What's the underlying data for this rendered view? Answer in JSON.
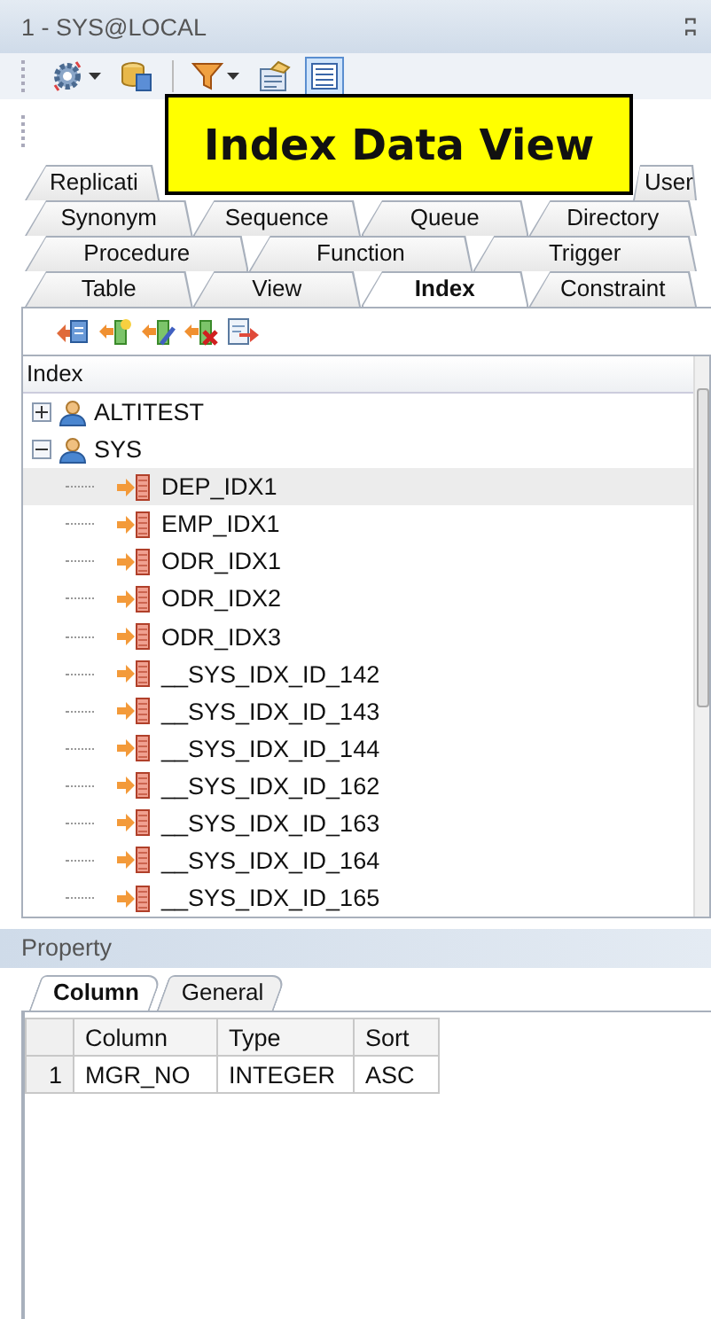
{
  "panel": {
    "title": "1 - SYS@LOCAL",
    "pin": "ʭ"
  },
  "toolbar": [
    {
      "kind": "gear",
      "dropdown": true,
      "pressed": false
    },
    {
      "kind": "database",
      "dropdown": false,
      "pressed": false
    },
    {
      "kind": "filter",
      "dropdown": true,
      "pressed": false
    },
    {
      "kind": "properties",
      "dropdown": false,
      "pressed": false
    },
    {
      "kind": "list",
      "dropdown": false,
      "pressed": true
    }
  ],
  "callout": {
    "text": "Index Data View"
  },
  "object_tab_rows": [
    [
      {
        "label": "Replicati",
        "selected": false
      },
      {
        "label": "User",
        "selected": false
      }
    ],
    [
      {
        "label": "Synonym",
        "selected": false
      },
      {
        "label": "Sequence",
        "selected": false
      },
      {
        "label": "Queue",
        "selected": false
      },
      {
        "label": "Directory",
        "selected": false
      }
    ],
    [
      {
        "label": "Procedure",
        "selected": false
      },
      {
        "label": "Function",
        "selected": false
      },
      {
        "label": "Trigger",
        "selected": false
      }
    ],
    [
      {
        "label": "Table",
        "selected": false
      },
      {
        "label": "View",
        "selected": false
      },
      {
        "label": "Index",
        "selected": true
      },
      {
        "label": "Constraint",
        "selected": false
      }
    ]
  ],
  "index_toolbar": [
    {
      "kind": "create"
    },
    {
      "kind": "add"
    },
    {
      "kind": "edit"
    },
    {
      "kind": "delete"
    },
    {
      "kind": "export"
    }
  ],
  "tree": {
    "header": "Index",
    "items": [
      {
        "label": "ALTITEST",
        "expanded": false,
        "selected": false
      },
      {
        "label": "SYS",
        "expanded": true,
        "selected": false,
        "children": [
          {
            "label": "DEP_IDX1",
            "selected": true
          },
          {
            "label": "EMP_IDX1",
            "selected": false
          },
          {
            "label": "ODR_IDX1",
            "selected": false
          },
          {
            "label": "ODR_IDX2",
            "selected": false
          },
          {
            "label": "ODR_IDX3",
            "selected": false
          },
          {
            "label": "__SYS_IDX_ID_142",
            "selected": false
          },
          {
            "label": "__SYS_IDX_ID_143",
            "selected": false
          },
          {
            "label": "__SYS_IDX_ID_144",
            "selected": false
          },
          {
            "label": "__SYS_IDX_ID_162",
            "selected": false
          },
          {
            "label": "__SYS_IDX_ID_163",
            "selected": false
          },
          {
            "label": "__SYS_IDX_ID_164",
            "selected": false
          },
          {
            "label": "__SYS_IDX_ID_165",
            "selected": false
          }
        ]
      }
    ]
  },
  "property": {
    "title": "Property",
    "tabs": [
      {
        "label": "Column",
        "selected": true
      },
      {
        "label": "General",
        "selected": false
      }
    ],
    "grid": {
      "columns": [
        "Column",
        "Type",
        "Sort"
      ],
      "rows": [
        {
          "number": "1",
          "cells": [
            "MGR_NO",
            "INTEGER",
            "ASC"
          ]
        }
      ]
    }
  }
}
